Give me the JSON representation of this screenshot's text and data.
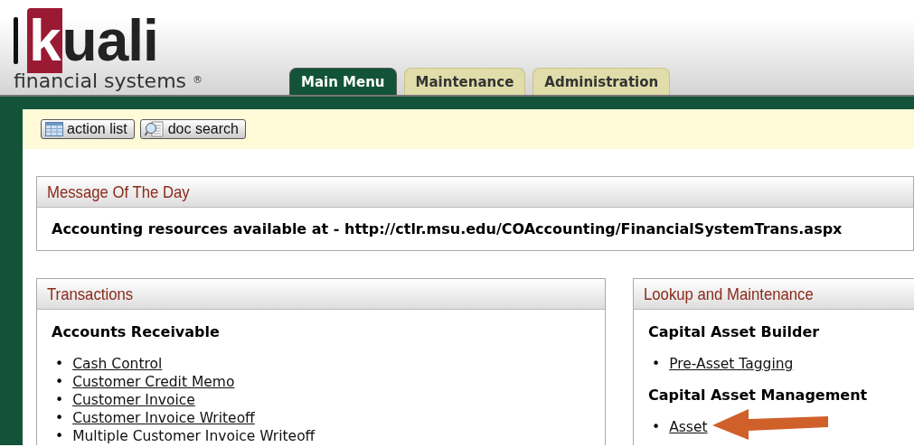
{
  "logo": {
    "word": "kuali",
    "tagline": "financial systems",
    "mark": "®"
  },
  "tabs": [
    {
      "label": "Main Menu",
      "selected": true
    },
    {
      "label": "Maintenance",
      "selected": false
    },
    {
      "label": "Administration",
      "selected": false
    }
  ],
  "toolbar": [
    {
      "label": "action list",
      "kind": "list"
    },
    {
      "label": "doc search",
      "kind": "search"
    }
  ],
  "message": {
    "title": "Message Of The Day",
    "text": "Accounting resources available at - http://ctlr.msu.edu/COAccounting/FinancialSystemTrans.aspx"
  },
  "panels": [
    {
      "title": "Transactions",
      "groups": [
        {
          "heading": "Accounts Receivable",
          "marker": "•",
          "links": [
            {
              "label": "Cash Control",
              "underlined": true
            },
            {
              "label": "Customer Credit Memo",
              "underlined": true
            },
            {
              "label": "Customer Invoice",
              "underlined": true
            },
            {
              "label": "Customer Invoice Writeoff",
              "underlined": true
            },
            {
              "label": "Multiple Customer Invoice Writeoff",
              "underlined": false
            }
          ]
        }
      ]
    },
    {
      "title": "Lookup and Maintenance",
      "groups": [
        {
          "heading": "Capital Asset Builder",
          "marker": "•",
          "links": [
            {
              "label": "Pre-Asset Tagging",
              "underlined": true
            }
          ]
        },
        {
          "heading": "Capital Asset Management",
          "marker": "•",
          "links": [
            {
              "label": "Asset",
              "underlined": true
            }
          ]
        }
      ]
    }
  ]
}
